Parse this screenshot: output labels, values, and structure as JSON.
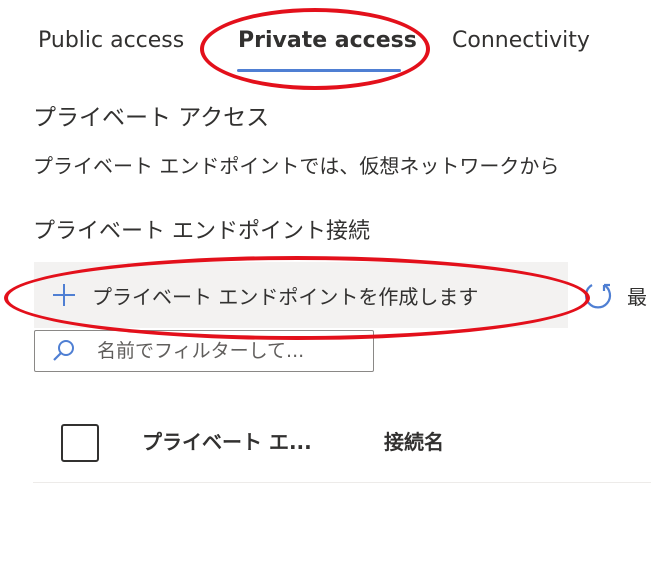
{
  "tabs": [
    {
      "label": "Public access",
      "active": false
    },
    {
      "label": "Private access",
      "active": true
    },
    {
      "label": "Connectivity",
      "active": false
    }
  ],
  "section": {
    "title": "プライベート アクセス",
    "description": "プライベート エンドポイントでは、仮想ネットワークから"
  },
  "endpoints": {
    "title": "プライベート エンドポイント接続",
    "commands": {
      "create_label": "プライベート エンドポイントを作成します",
      "create_icon": "plus-icon",
      "refresh_label": "最",
      "refresh_icon": "refresh-icon"
    },
    "search": {
      "placeholder": "名前でフィルターして...",
      "value": "",
      "icon": "search-icon"
    },
    "table": {
      "columns": [
        "プライベート エ...",
        "接続名"
      ],
      "rows": []
    }
  },
  "colors": {
    "accent": "#4f7fd3",
    "annotation": "#e3101b",
    "command_bg": "#f3f2f1"
  }
}
